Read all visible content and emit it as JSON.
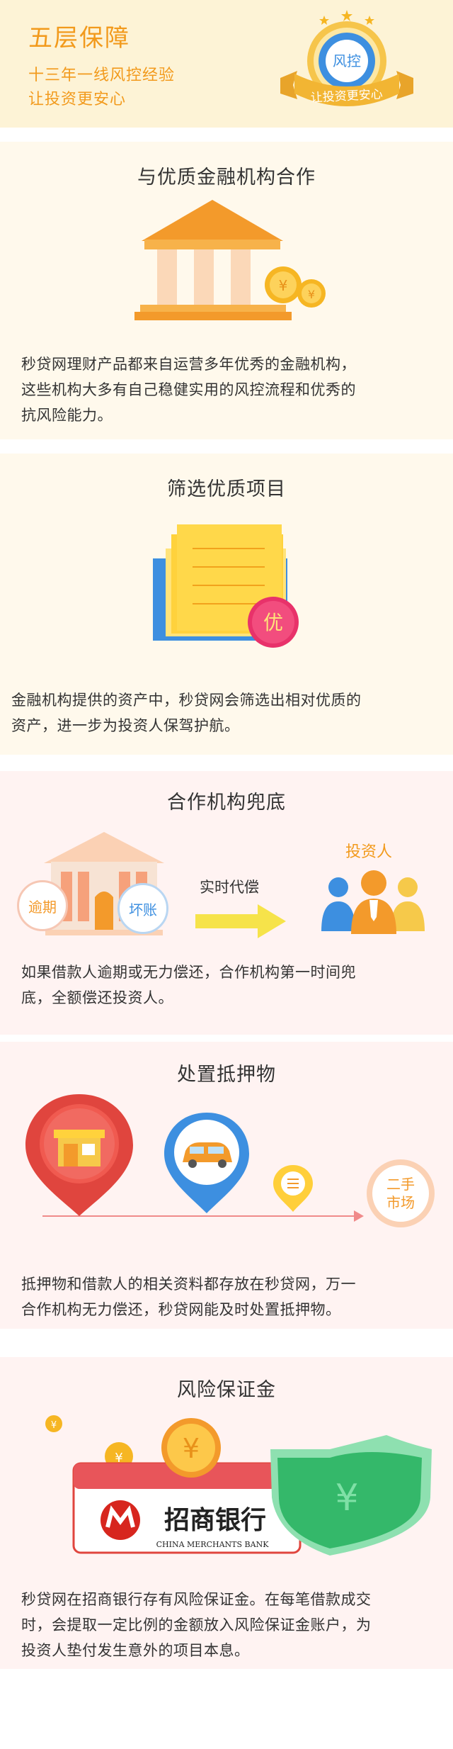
{
  "hero": {
    "title": "五层保障",
    "line1": "十三年一线风控经验",
    "line2": "让投资更安心",
    "badge_center": "风控",
    "badge_ribbon": "让投资更安心"
  },
  "sections": [
    {
      "title": "与优质金融机构合作",
      "text": [
        "秒贷网理财产品都来自运营多年优秀的金融机构，",
        "这些机构大多有自己稳健实用的风控流程和优秀的",
        "抗风险能力。"
      ],
      "coin_symbol": "¥"
    },
    {
      "title": "筛选优质项目",
      "text": [
        "金融机构提供的资产中，秒贷网会筛选出相对优质的",
        "资产，进一步为投资人保驾护航。"
      ],
      "badge": "优"
    },
    {
      "title": "合作机构兜底",
      "text": [
        "如果借款人逾期或无力偿还，合作机构第一时间兜",
        "底，全额偿还投资人。"
      ],
      "left_tag": "逾期",
      "right_tag": "坏账",
      "arrow_label": "实时代偿",
      "investor_label": "投资人"
    },
    {
      "title": "处置抵押物",
      "text": [
        "抵押物和借款人的相关资料都存放在秒贷网，万一",
        "合作机构无力偿还，秒贷网能及时处置抵押物。"
      ],
      "market_label_1": "二手",
      "market_label_2": "市场"
    },
    {
      "title": "风险保证金",
      "text": [
        "秒贷网在招商银行存有风险保证金。在每笔借款成交",
        "时，会提取一定比例的金额放入风险保证金账户，为",
        "投资人垫付发生意外的项目本息。"
      ],
      "bank_name": "招商银行",
      "bank_name_en": "CHINA MERCHANTS BANK",
      "coin_symbol": "¥"
    }
  ],
  "colors": {
    "accent": "#f29a1c",
    "orange": "#f39a2b",
    "blue": "#3d8fe0",
    "red": "#e0453e",
    "green": "#34b86a",
    "yellow": "#ffd23c"
  }
}
